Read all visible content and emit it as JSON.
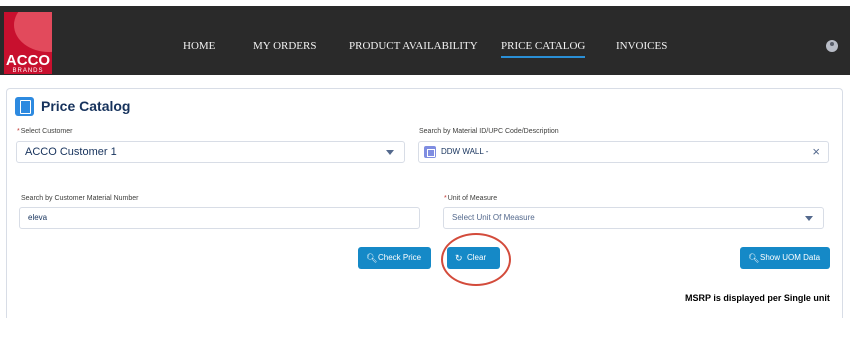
{
  "brand": {
    "name": "ACCO",
    "sub": "BRANDS"
  },
  "nav": {
    "items": [
      {
        "label": "HOME"
      },
      {
        "label": "MY ORDERS"
      },
      {
        "label": "PRODUCT AVAILABILITY"
      },
      {
        "label": "PRICE CATALOG",
        "active": true
      },
      {
        "label": "INVOICES"
      }
    ]
  },
  "page": {
    "title": "Price Catalog"
  },
  "form": {
    "customer": {
      "required_mark": "*",
      "label": "Select Customer",
      "value": "ACCO Customer 1"
    },
    "material_search": {
      "label": "Search by Material ID/UPC Code/Description",
      "value": "DDW WALL -"
    },
    "customer_material": {
      "label": "Search by Customer Material Number",
      "value": "eleva"
    },
    "uom": {
      "required_mark": "*",
      "label": "Unit of Measure",
      "placeholder": "Select Unit Of Measure"
    }
  },
  "buttons": {
    "check_price": "Check Price",
    "clear": "Clear",
    "show_uom": "Show UOM Data"
  },
  "footer_note": "MSRP is displayed per Single unit",
  "colors": {
    "accent": "#1589c7",
    "brand": "#c8102e",
    "annotation": "#d34b3b"
  },
  "icons": {
    "search": "search-icon",
    "refresh": "refresh-icon",
    "user": "user-icon"
  }
}
